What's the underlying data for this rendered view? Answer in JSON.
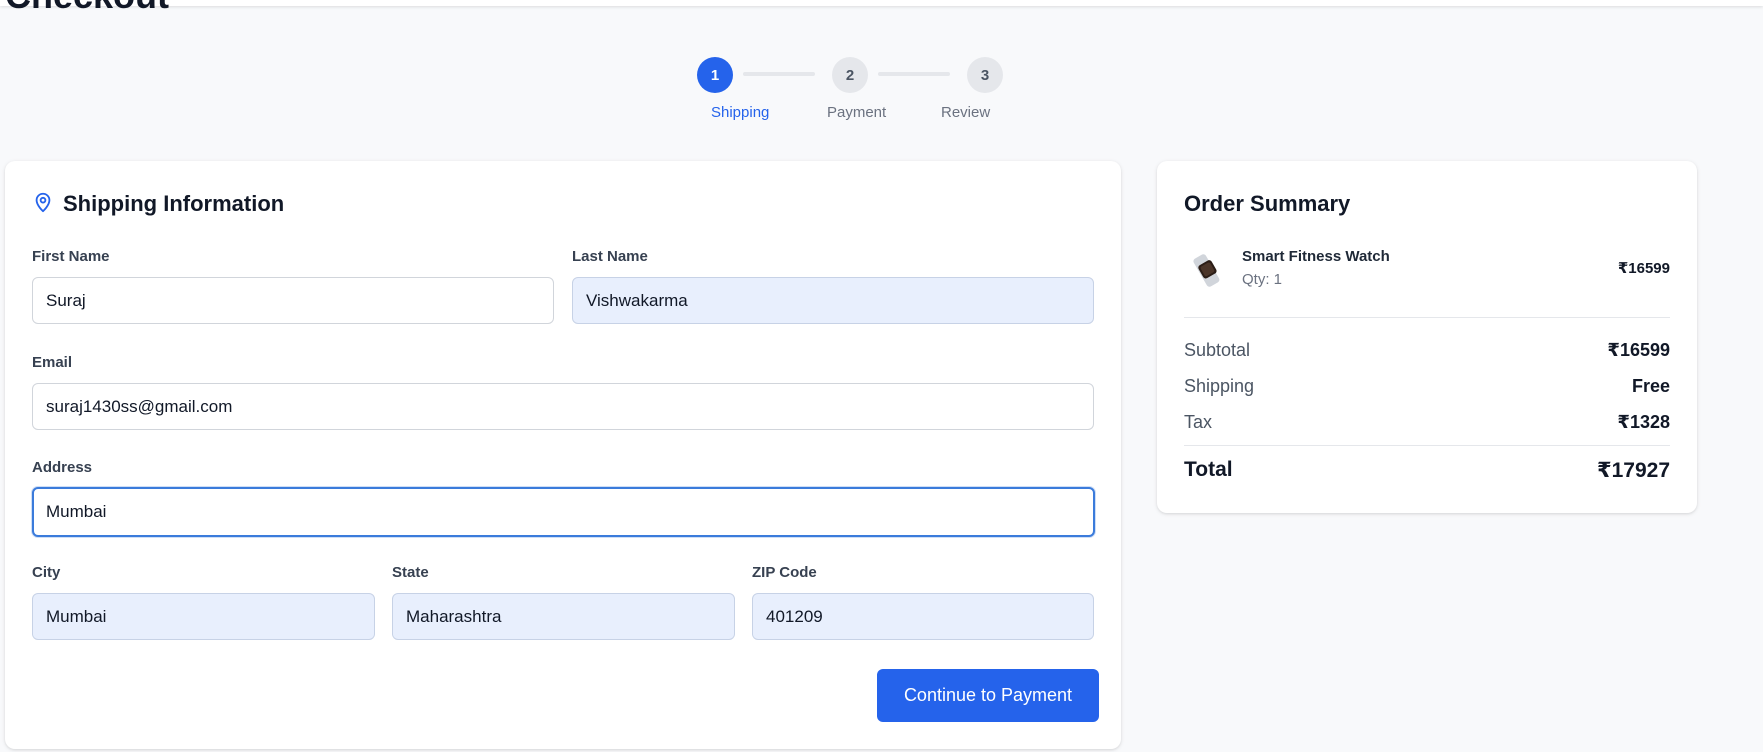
{
  "page": {
    "title": "Checkout"
  },
  "stepper": {
    "steps": [
      {
        "number": "1",
        "label": "Shipping",
        "state": "active"
      },
      {
        "number": "2",
        "label": "Payment",
        "state": "inactive"
      },
      {
        "number": "3",
        "label": "Review",
        "state": "inactive"
      }
    ]
  },
  "shipping": {
    "title": "Shipping Information",
    "icon": "map-pin-icon",
    "fields": {
      "first_name": {
        "label": "First Name",
        "value": "Suraj"
      },
      "last_name": {
        "label": "Last Name",
        "value": "Vishwakarma"
      },
      "email": {
        "label": "Email",
        "value": "suraj1430ss@gmail.com"
      },
      "address": {
        "label": "Address",
        "value": "Mumbai"
      },
      "city": {
        "label": "City",
        "value": "Mumbai"
      },
      "state": {
        "label": "State",
        "value": "Maharashtra"
      },
      "zip": {
        "label": "ZIP Code",
        "value": "401209"
      }
    },
    "continue_label": "Continue to Payment"
  },
  "summary": {
    "title": "Order Summary",
    "items": [
      {
        "name": "Smart Fitness Watch",
        "qty": "Qty: 1",
        "price": "₹16599"
      }
    ],
    "subtotal": {
      "label": "Subtotal",
      "value": "₹16599"
    },
    "shipping": {
      "label": "Shipping",
      "value": "Free"
    },
    "tax": {
      "label": "Tax",
      "value": "₹1328"
    },
    "total": {
      "label": "Total",
      "value": "₹17927"
    }
  },
  "colors": {
    "accent": "#2563eb",
    "autofill_bg": "#e8effd",
    "page_bg": "#f8f9fb"
  }
}
